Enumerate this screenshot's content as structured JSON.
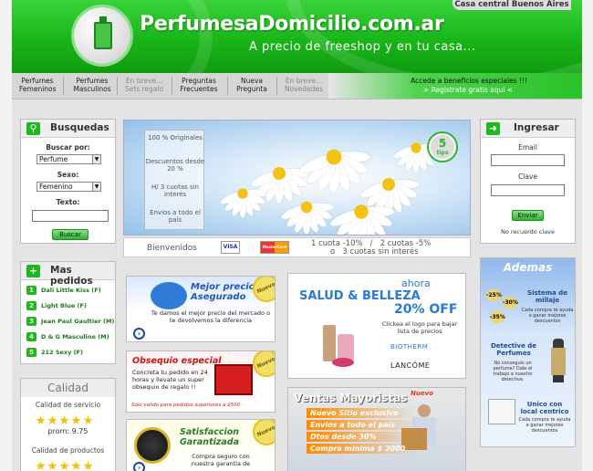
{
  "header": {
    "site_title": "PerfumesaDomicilio.com.ar",
    "tagline": "A precio de freeshop y en tu casa...",
    "hq_tab": "Casa central Buenos Aires"
  },
  "nav": {
    "items": [
      {
        "line1": "Perfumes",
        "line2": "Femeninos"
      },
      {
        "line1": "Perfumes",
        "line2": "Masculinos"
      },
      {
        "line1": "En breve...",
        "line2": "Sets regalo"
      },
      {
        "line1": "Preguntas",
        "line2": "Frecuentes"
      },
      {
        "line1": "Nueva",
        "line2": "Pregunta"
      },
      {
        "line1": "En breve...",
        "line2": "Novedades"
      }
    ],
    "promo_line1": "Accede a beneficios especiales !!!",
    "promo_line2": "> Registrate gratis aqui <"
  },
  "search": {
    "title": "Busquedas",
    "buscar_por_label": "Buscar por:",
    "buscar_por_value": "Perfume",
    "sexo_label": "Sexo:",
    "sexo_value": "Femenino",
    "texto_label": "Texto:",
    "button": "Buscar"
  },
  "popular": {
    "title": "Mas pedidos",
    "items": [
      {
        "num": "1",
        "label": "Dali Little Kiss (F)"
      },
      {
        "num": "2",
        "label": "Light Blue (F)"
      },
      {
        "num": "3",
        "label": "Jean Paul Gaultier (M)"
      },
      {
        "num": "4",
        "label": "D & G Masculine (M)"
      },
      {
        "num": "5",
        "label": "212 Sexy (F)"
      }
    ]
  },
  "quality": {
    "title": "Calidad",
    "service_label": "Calidad de servicio",
    "service_rating": 5,
    "score": "prom: 9.75",
    "products_label": "Calidad de productos",
    "products_rating": 5
  },
  "hero": {
    "items": [
      "100 % Originales",
      "Descuentos desde 20 %",
      "H/ 3 cuotas sin interés",
      "Envios a todo el país"
    ],
    "badge_number": "5",
    "badge_text": "tips"
  },
  "welcome": {
    "label": "Bienvenidos",
    "card1": "VISA",
    "card2": "MasterCard",
    "installments_line1": "1 cuota -10%   /   2 cuotas -5%",
    "installments_line2": "o   3 cuotas sin interés"
  },
  "login": {
    "title": "Ingresar",
    "email_label": "Email",
    "password_label": "Clave",
    "button": "Enviar",
    "forgot": "No recuerdo clave"
  },
  "banners": {
    "mejor_precio": {
      "title": "Mejor precio Asegurado",
      "body": "Te damos el mejor precio del mercado o te devolvemos la diferencia",
      "badge": "Nuevo"
    },
    "obsequio": {
      "title": "Obsequio especial",
      "body": "Concreta tu pedido en 24 horas y llevate un super obsequio de regalo !!",
      "note": "Solo valido para pedidos superiores a $500",
      "badge": "Nuevo"
    },
    "satisfaccion": {
      "title": "Satisfaccion Garantizada",
      "body": "Compra seguro con nuestra garantía de",
      "badge": "Nuevo"
    },
    "beauty": {
      "ahora": "ahora",
      "title": "SALUD & BELLEZA",
      "discount": "20% OFF",
      "body": "Clickea el logo para bajar lista de precios",
      "brand1": "BIOTHERM",
      "brand2": "LANCÔME"
    },
    "mayoristas": {
      "title": "Ventas Mayoristas",
      "badge": "Nuevo",
      "items": [
        "Nuevo Sitio exclusivo",
        "Envios a todo el país",
        "Dtos desde 30%",
        "Compra minima $ 3000"
      ]
    }
  },
  "ademas": {
    "title": "Ademas",
    "items": [
      {
        "title": "Sistema de millaje",
        "body": "Cada compra te ayuda a ganar mejores descuentos"
      },
      {
        "title": "Detective de Perfumes",
        "body": "No conseguis un perfume? Dale el trabajo a nuestro detective."
      },
      {
        "title": "Unico con local centrico",
        "body": "Cada compra te ayuda a ganar mejores descuentos"
      }
    ]
  },
  "colors": {
    "brand_green": "#1eb81e",
    "link_green": "#1a7a1a",
    "banner_blue": "#1a4a9a"
  }
}
